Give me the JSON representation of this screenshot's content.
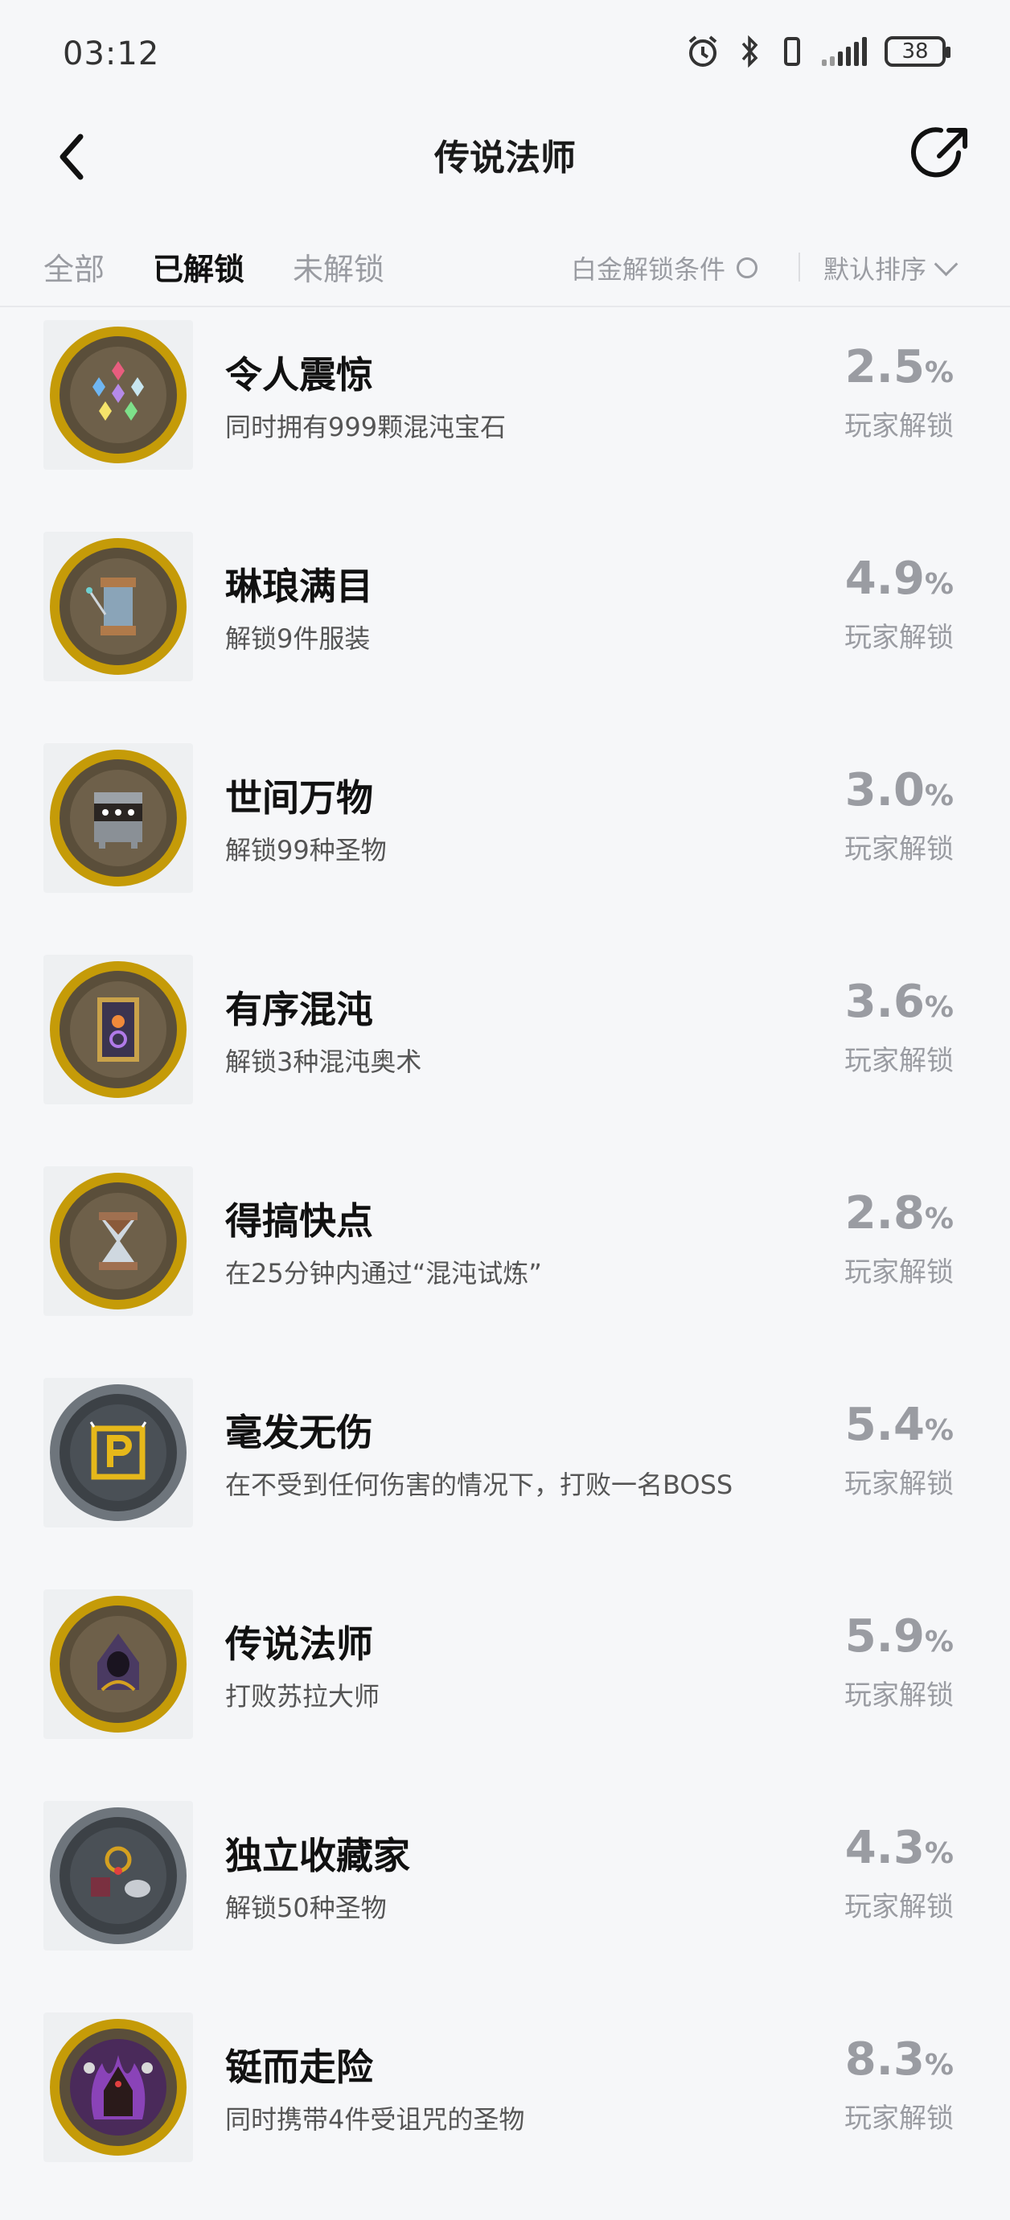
{
  "status_bar": {
    "time": "03:12",
    "battery": "38"
  },
  "header": {
    "title": "传说法师"
  },
  "tabs": [
    {
      "label": "全部"
    },
    {
      "label": "已解锁"
    },
    {
      "label": "未解锁"
    }
  ],
  "filter": {
    "condition_label": "白金解锁条件",
    "sort_label": "默认排序"
  },
  "achievements": [
    {
      "title": "令人震惊",
      "desc": "同时拥有999颗混沌宝石",
      "percent": "2.5",
      "unit": "%",
      "unlock_label": "玩家解锁",
      "badge": "gold",
      "icon": "crystals-icon"
    },
    {
      "title": "琳琅满目",
      "desc": "解锁9件服装",
      "percent": "4.9",
      "unit": "%",
      "unlock_label": "玩家解锁",
      "badge": "gold",
      "icon": "thread-spool-icon"
    },
    {
      "title": "世间万物",
      "desc": "解锁99种圣物",
      "percent": "3.0",
      "unit": "%",
      "unlock_label": "玩家解锁",
      "badge": "gold",
      "icon": "relic-chest-icon"
    },
    {
      "title": "有序混沌",
      "desc": "解锁3种混沌奥术",
      "percent": "3.6",
      "unit": "%",
      "unlock_label": "玩家解锁",
      "badge": "gold",
      "icon": "arcana-card-icon"
    },
    {
      "title": "得搞快点",
      "desc": "在25分钟内通过“混沌试炼”",
      "percent": "2.8",
      "unit": "%",
      "unlock_label": "玩家解锁",
      "badge": "gold",
      "icon": "hourglass-icon"
    },
    {
      "title": "毫发无伤",
      "desc": "在不受到任何伤害的情况下，打败一名BOSS",
      "percent": "5.4",
      "unit": "%",
      "unlock_label": "玩家解锁",
      "badge": "silver",
      "icon": "p-sign-icon"
    },
    {
      "title": "传说法师",
      "desc": "打败苏拉大师",
      "percent": "5.9",
      "unit": "%",
      "unlock_label": "玩家解锁",
      "badge": "gold",
      "icon": "hooded-wizard-icon"
    },
    {
      "title": "独立收藏家",
      "desc": "解锁50种圣物",
      "percent": "4.3",
      "unit": "%",
      "unlock_label": "玩家解锁",
      "badge": "silver",
      "icon": "relic-collection-icon"
    },
    {
      "title": "铤而走险",
      "desc": "同时携带4件受诅咒的圣物",
      "percent": "8.3",
      "unit": "%",
      "unlock_label": "玩家解锁",
      "badge": "gold",
      "icon": "cursed-figure-icon"
    }
  ]
}
